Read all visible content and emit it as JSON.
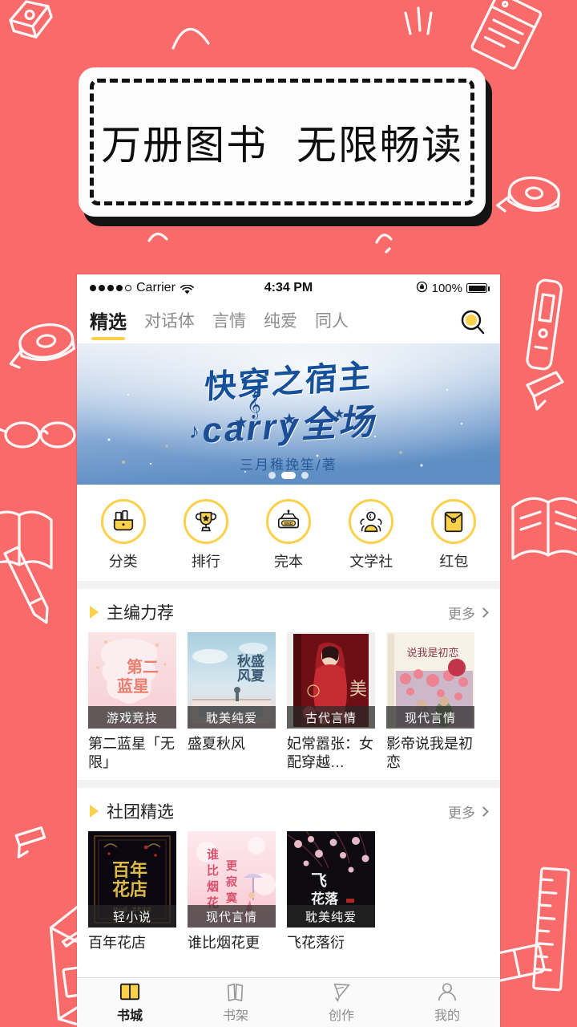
{
  "theme": {
    "background": "#F96B6B",
    "accent_yellow": "#FBD14B",
    "text_dark": "#1b1b1b",
    "muted": "#8d8d8d"
  },
  "promo": {
    "text": "万册图书  无限畅读"
  },
  "status_bar": {
    "carrier": "Carrier",
    "time": "4:34 PM",
    "battery": "100%",
    "signal_dots_filled": 4,
    "signal_dots_total": 5,
    "wifi_icon": "wifi-icon",
    "lock_icon": "rotation-lock-icon",
    "battery_icon": "battery-icon"
  },
  "nav": {
    "tabs": [
      {
        "label": "精选",
        "active": true
      },
      {
        "label": "对话体",
        "active": false
      },
      {
        "label": "言情",
        "active": false
      },
      {
        "label": "纯爱",
        "active": false
      },
      {
        "label": "同人",
        "active": false
      }
    ],
    "search_icon": "search-icon"
  },
  "hero": {
    "title_line1": "快穿之宿主",
    "title_line2": "carry全场",
    "author": "三月稚挽笙/著",
    "dots_total": 3,
    "dots_active_index": 1
  },
  "quick_actions": [
    {
      "label": "分类",
      "icon": "category-bag-icon"
    },
    {
      "label": "排行",
      "icon": "trophy-icon"
    },
    {
      "label": "完本",
      "icon": "end-sign-icon"
    },
    {
      "label": "文学社",
      "icon": "people-group-icon"
    },
    {
      "label": "红包",
      "icon": "red-envelope-icon"
    }
  ],
  "sections": [
    {
      "title": "主编力荐",
      "more_label": "更多",
      "books": [
        {
          "title": "第二蓝星「无限」",
          "tag": "游戏竞技",
          "cover_style": "pink-blossom"
        },
        {
          "title": "盛夏秋风",
          "tag": "耽美纯爱",
          "cover_style": "blue-sky"
        },
        {
          "title": "妃常嚣张：女配穿越…",
          "tag": "古代言情",
          "cover_style": "red-hanfu"
        },
        {
          "title": "影帝说我是初恋",
          "tag": "现代言情",
          "cover_style": "cherry-cream"
        }
      ]
    },
    {
      "title": "社团精选",
      "more_label": "更多",
      "books": [
        {
          "title": "百年花店",
          "tag": "轻小说",
          "cover_style": "dark-gold"
        },
        {
          "title": "谁比烟花更",
          "tag": "现代言情",
          "cover_style": "pink-umbrella"
        },
        {
          "title": "飞花落衍",
          "tag": "耽美纯爱",
          "cover_style": "dark-blossom"
        }
      ]
    }
  ],
  "tabbar": [
    {
      "label": "书城",
      "icon": "open-book-icon",
      "active": true
    },
    {
      "label": "书架",
      "icon": "bookshelf-icon",
      "active": false
    },
    {
      "label": "创作",
      "icon": "pen-nib-icon",
      "active": false
    },
    {
      "label": "我的",
      "icon": "user-icon",
      "active": false
    }
  ]
}
